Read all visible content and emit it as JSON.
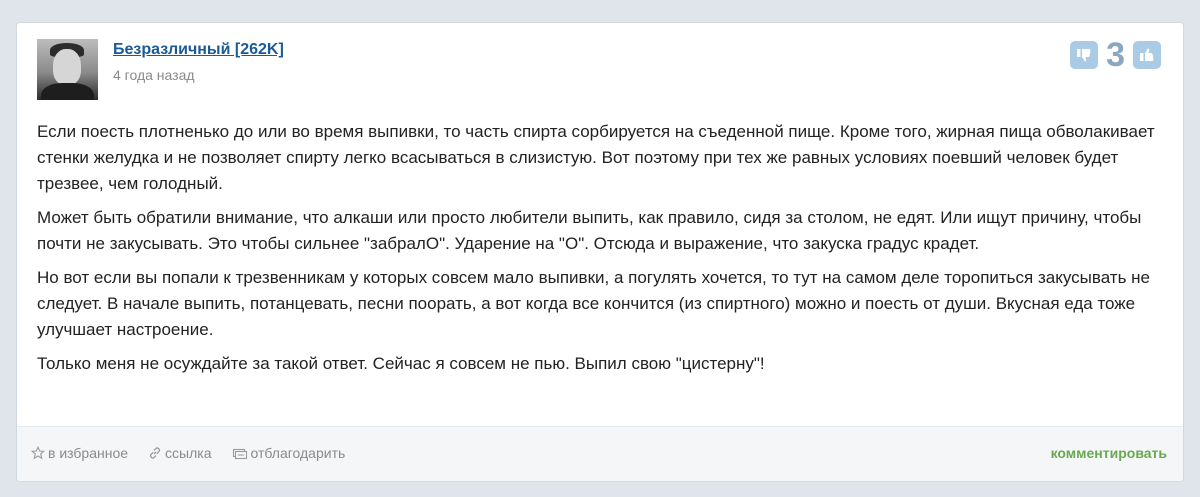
{
  "answer": {
    "author": {
      "name": "Безразличный [262K]",
      "time": "4 года назад"
    },
    "vote": {
      "score": "3",
      "down_icon": "thumbs-down-icon",
      "up_icon": "thumbs-up-icon"
    },
    "paragraphs": [
      "Если поесть плотненько до или во время выпивки, то часть спирта сорбируется на съеденной пище. Кроме того, жирная пища обволакивает стенки желудка и не позволяет спирту легко всасываться в слизистую. Вот поэтому при тех же равных условиях поевший человек будет трезвее, чем голодный.",
      "Может быть обратили внимание, что алкаши или просто любители выпить, как правило, сидя за столом, не едят. Или ищут причину, чтобы почти не закусывать. Это чтобы сильнее \"забралО\". Ударение на \"О\". Отсюда и выражение, что закуска градус крадет.",
      "Но вот если вы попали к трезвенникам у которых совсем мало выпивки, а погулять хочется, то тут на самом деле торопиться закусывать не следует. В начале выпить, потанцевать, песни поорать, а вот когда все кончится (из спиртного) можно и поесть от души. Вкусная еда тоже улучшает настроение.",
      "Только меня не осуждайте за такой ответ. Сейчас я совсем не пью. Выпил свою \"цистерну\"!"
    ],
    "footer": {
      "favorite_label": "в избранное",
      "link_label": "ссылка",
      "thank_label": "отблагодарить",
      "comment_label": "комментировать"
    },
    "colors": {
      "author_link": "#1a5a96",
      "vote_score": "#8aa7bf",
      "thumb_bg": "#a9cbe6",
      "comment_link": "#6aa84f"
    }
  }
}
